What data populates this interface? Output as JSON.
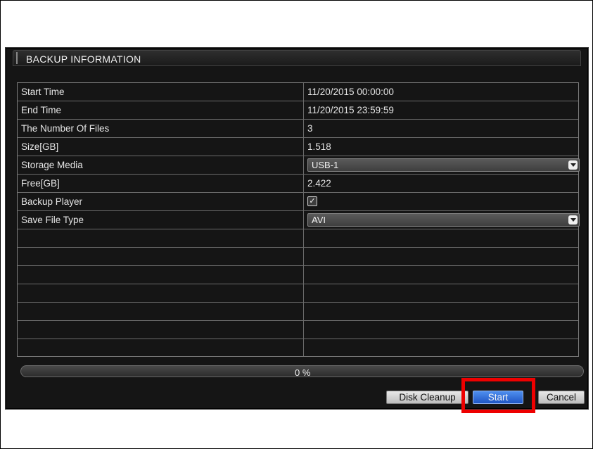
{
  "dialog": {
    "title": "BACKUP INFORMATION"
  },
  "rows": [
    {
      "label": "Start Time",
      "value": "11/20/2015 00:00:00"
    },
    {
      "label": "End Time",
      "value": "11/20/2015 23:59:59"
    },
    {
      "label": "The Number Of Files",
      "value": "3"
    },
    {
      "label": "Size[GB]",
      "value": "1.518"
    },
    {
      "label": "Storage Media",
      "value": "USB-1"
    },
    {
      "label": "Free[GB]",
      "value": "2.422"
    },
    {
      "label": "Backup Player",
      "checked": true
    },
    {
      "label": "Save File Type",
      "value": "AVI"
    }
  ],
  "progress": {
    "text": "0 %",
    "value": 0
  },
  "buttons": {
    "disk_cleanup": "Disk Cleanup",
    "start": "Start",
    "cancel": "Cancel"
  },
  "icons": {
    "dropdown": "chevron-down-icon",
    "checkbox": "checkmark-icon"
  },
  "colors": {
    "highlight": "#ee0000",
    "start_button": "#2f6fdc",
    "background": "#151515"
  }
}
